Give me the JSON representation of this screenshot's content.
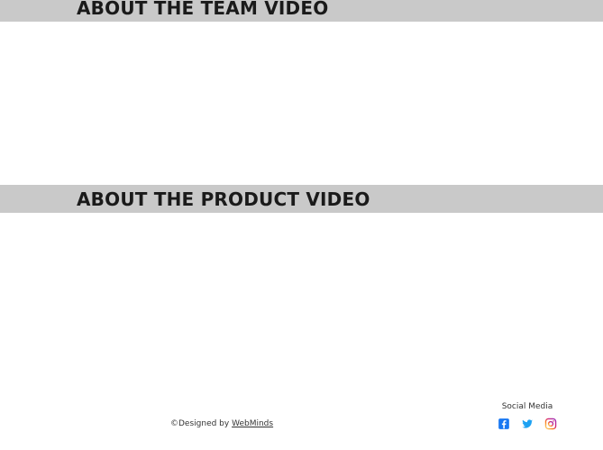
{
  "sections": {
    "team_title": "ABOUT THE TEAM VIDEO",
    "product_title": "ABOUT THE PRODUCT VIDEO"
  },
  "footer": {
    "designed_by_prefix": "©Designed by ",
    "designed_by_link": "WebMinds",
    "social_heading": "Social Media",
    "social_icons": [
      "facebook-icon",
      "twitter-icon",
      "instagram-icon"
    ]
  },
  "colors": {
    "band_background": "#c9c9c9",
    "title_text": "#1a1a1a",
    "facebook": "#1877f2",
    "twitter": "#1da1f2",
    "instagram": "#d62976"
  }
}
